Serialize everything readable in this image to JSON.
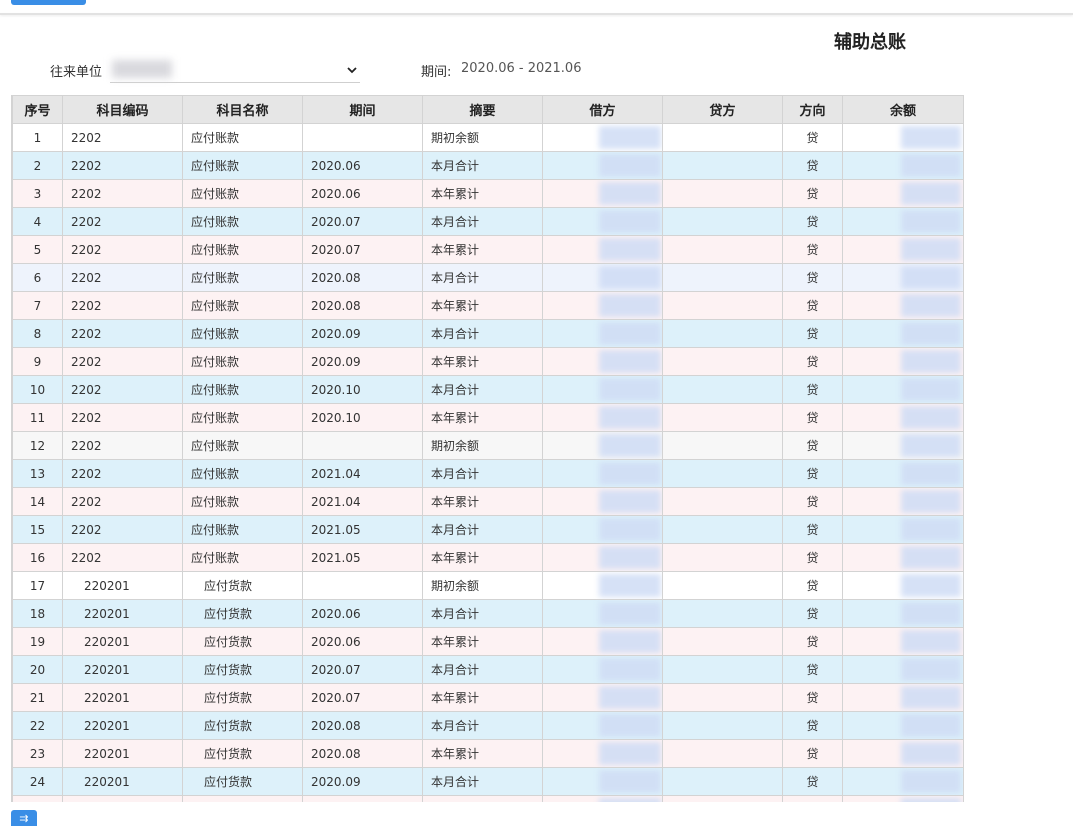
{
  "title": "辅助总账",
  "filter": {
    "unit_label": "往来单位",
    "unit_value": "",
    "period_label": "期间:",
    "period_value": "2020.06 - 2021.06"
  },
  "table": {
    "headers": [
      "序号",
      "科目编码",
      "科目名称",
      "期间",
      "摘要",
      "借方",
      "贷方",
      "方向",
      "余额"
    ],
    "rows": [
      {
        "no": "1",
        "code": "2202",
        "name": "应付账款",
        "period": "",
        "summary": "期初余额",
        "dir": "贷",
        "style": "white",
        "indent": false
      },
      {
        "no": "2",
        "code": "2202",
        "name": "应付账款",
        "period": "2020.06",
        "summary": "本月合计",
        "dir": "贷",
        "style": "blue",
        "indent": false
      },
      {
        "no": "3",
        "code": "2202",
        "name": "应付账款",
        "period": "2020.06",
        "summary": "本年累计",
        "dir": "贷",
        "style": "pink",
        "indent": false
      },
      {
        "no": "4",
        "code": "2202",
        "name": "应付账款",
        "period": "2020.07",
        "summary": "本月合计",
        "dir": "贷",
        "style": "blue",
        "indent": false
      },
      {
        "no": "5",
        "code": "2202",
        "name": "应付账款",
        "period": "2020.07",
        "summary": "本年累计",
        "dir": "贷",
        "style": "pink",
        "indent": false
      },
      {
        "no": "6",
        "code": "2202",
        "name": "应付账款",
        "period": "2020.08",
        "summary": "本月合计",
        "dir": "贷",
        "style": "lav",
        "indent": false
      },
      {
        "no": "7",
        "code": "2202",
        "name": "应付账款",
        "period": "2020.08",
        "summary": "本年累计",
        "dir": "贷",
        "style": "pink",
        "indent": false
      },
      {
        "no": "8",
        "code": "2202",
        "name": "应付账款",
        "period": "2020.09",
        "summary": "本月合计",
        "dir": "贷",
        "style": "blue",
        "indent": false
      },
      {
        "no": "9",
        "code": "2202",
        "name": "应付账款",
        "period": "2020.09",
        "summary": "本年累计",
        "dir": "贷",
        "style": "pink",
        "indent": false
      },
      {
        "no": "10",
        "code": "2202",
        "name": "应付账款",
        "period": "2020.10",
        "summary": "本月合计",
        "dir": "贷",
        "style": "blue",
        "indent": false
      },
      {
        "no": "11",
        "code": "2202",
        "name": "应付账款",
        "period": "2020.10",
        "summary": "本年累计",
        "dir": "贷",
        "style": "pink",
        "indent": false
      },
      {
        "no": "12",
        "code": "2202",
        "name": "应付账款",
        "period": "",
        "summary": "期初余额",
        "dir": "贷",
        "style": "grey",
        "indent": false
      },
      {
        "no": "13",
        "code": "2202",
        "name": "应付账款",
        "period": "2021.04",
        "summary": "本月合计",
        "dir": "贷",
        "style": "blue",
        "indent": false
      },
      {
        "no": "14",
        "code": "2202",
        "name": "应付账款",
        "period": "2021.04",
        "summary": "本年累计",
        "dir": "贷",
        "style": "pink",
        "indent": false
      },
      {
        "no": "15",
        "code": "2202",
        "name": "应付账款",
        "period": "2021.05",
        "summary": "本月合计",
        "dir": "贷",
        "style": "blue",
        "indent": false
      },
      {
        "no": "16",
        "code": "2202",
        "name": "应付账款",
        "period": "2021.05",
        "summary": "本年累计",
        "dir": "贷",
        "style": "pink",
        "indent": false
      },
      {
        "no": "17",
        "code": "220201",
        "name": "应付货款",
        "period": "",
        "summary": "期初余额",
        "dir": "贷",
        "style": "white",
        "indent": true
      },
      {
        "no": "18",
        "code": "220201",
        "name": "应付货款",
        "period": "2020.06",
        "summary": "本月合计",
        "dir": "贷",
        "style": "blue",
        "indent": true
      },
      {
        "no": "19",
        "code": "220201",
        "name": "应付货款",
        "period": "2020.06",
        "summary": "本年累计",
        "dir": "贷",
        "style": "pink",
        "indent": true
      },
      {
        "no": "20",
        "code": "220201",
        "name": "应付货款",
        "period": "2020.07",
        "summary": "本月合计",
        "dir": "贷",
        "style": "blue",
        "indent": true
      },
      {
        "no": "21",
        "code": "220201",
        "name": "应付货款",
        "period": "2020.07",
        "summary": "本年累计",
        "dir": "贷",
        "style": "pink",
        "indent": true
      },
      {
        "no": "22",
        "code": "220201",
        "name": "应付货款",
        "period": "2020.08",
        "summary": "本月合计",
        "dir": "贷",
        "style": "blue",
        "indent": true
      },
      {
        "no": "23",
        "code": "220201",
        "name": "应付货款",
        "period": "2020.08",
        "summary": "本年累计",
        "dir": "贷",
        "style": "pink",
        "indent": true
      },
      {
        "no": "24",
        "code": "220201",
        "name": "应付货款",
        "period": "2020.09",
        "summary": "本月合计",
        "dir": "贷",
        "style": "blue",
        "indent": true
      },
      {
        "no": "",
        "code": "",
        "name": "",
        "period": "",
        "summary": "",
        "dir": "",
        "style": "pink",
        "indent": true
      }
    ]
  },
  "icons": {
    "dropdown": "chevron-down-icon",
    "bottom": "list-toggle-icon",
    "bottom_glyph": "⇉"
  },
  "colors": {
    "accent": "#3a8ee6",
    "header_bg": "#e6e6e6",
    "row_blue": "#ddf1fa",
    "row_pink": "#fdf2f3"
  }
}
